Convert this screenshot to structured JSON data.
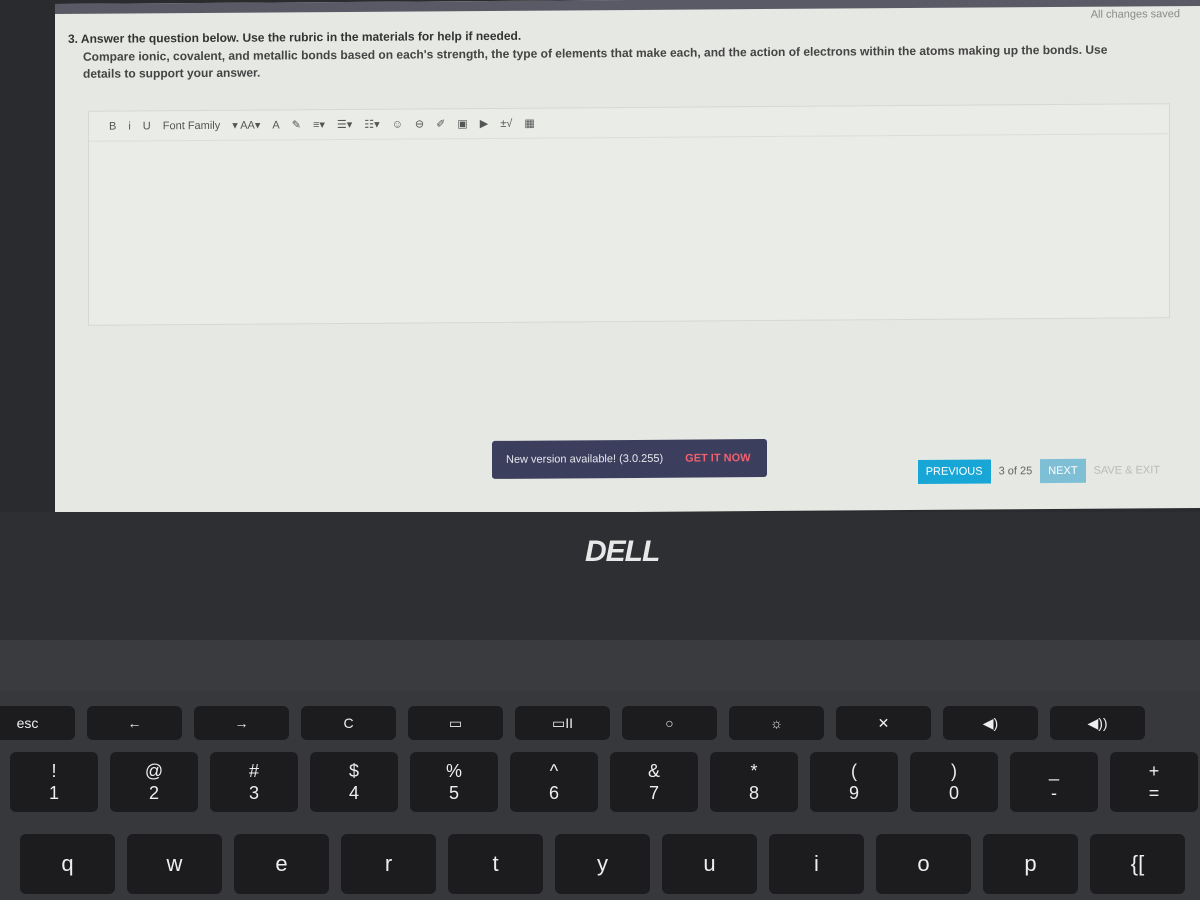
{
  "app": {
    "saved_status": "All changes saved"
  },
  "question": {
    "heading": "3. Answer the question below. Use the rubric in the materials for help if needed.",
    "prompt": "Compare ionic, covalent, and metallic bonds based on each's strength, the type of elements that make each, and the action of electrons within the atoms making up the bonds. Use details to support your answer."
  },
  "editor": {
    "value": "",
    "toolbar": [
      {
        "label": "B",
        "icon": "bold-icon"
      },
      {
        "label": "i",
        "icon": "italic-icon"
      },
      {
        "label": "U",
        "icon": "underline-icon"
      },
      {
        "label": "Font Family",
        "icon": "font-family-dropdown"
      },
      {
        "label": "▾ AA▾",
        "icon": "font-size-icon"
      },
      {
        "label": "A",
        "icon": "text-color-icon"
      },
      {
        "label": "✎",
        "icon": "highlight-icon"
      },
      {
        "label": "≡▾",
        "icon": "align-icon"
      },
      {
        "label": "☰▾",
        "icon": "ordered-list-icon"
      },
      {
        "label": "☷▾",
        "icon": "unordered-list-icon"
      },
      {
        "label": "☺",
        "icon": "emoji-icon"
      },
      {
        "label": "⊖",
        "icon": "link-icon"
      },
      {
        "label": "✐",
        "icon": "draw-icon"
      },
      {
        "label": "▣",
        "icon": "image-icon"
      },
      {
        "label": "▶",
        "icon": "video-icon"
      },
      {
        "label": "±√",
        "icon": "equation-icon"
      },
      {
        "label": "▦",
        "icon": "table-icon"
      }
    ]
  },
  "toast": {
    "message": "New version available! (3.0.255)",
    "action": "GET IT NOW"
  },
  "nav": {
    "previous": "PREVIOUS",
    "count": "3 of 25",
    "next": "NEXT",
    "save_exit": "SAVE & EXIT"
  },
  "colors": {
    "primary": "#18a6d6",
    "toast_bg": "#3b3e5c",
    "toast_action": "#f06070"
  },
  "laptop": {
    "brand": "DELL"
  },
  "keyboard": {
    "top": [
      "esc",
      "←",
      "→",
      "C",
      "▭",
      "▭II",
      "○",
      "☼",
      "✕",
      "◀)",
      "◀))"
    ],
    "numbers": [
      [
        "!",
        "1"
      ],
      [
        "@",
        "2"
      ],
      [
        "#",
        "3"
      ],
      [
        "$",
        "4"
      ],
      [
        "%",
        "5"
      ],
      [
        "^",
        "6"
      ],
      [
        "&",
        "7"
      ],
      [
        "*",
        "8"
      ],
      [
        "(",
        "9"
      ],
      [
        ")",
        "0"
      ],
      [
        "_",
        "-"
      ],
      [
        "+",
        "="
      ]
    ],
    "letters": [
      "q",
      "w",
      "e",
      "r",
      "t",
      "y",
      "u",
      "i",
      "o",
      "p",
      "{["
    ]
  }
}
